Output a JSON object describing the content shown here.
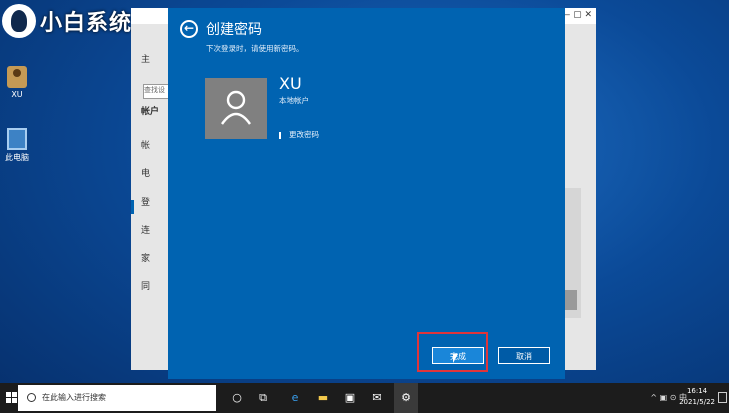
{
  "watermark": {
    "text": "小白系统"
  },
  "desktop": {
    "icons": [
      {
        "label": "XU",
        "icon": "user-folder-icon"
      },
      {
        "label": "此电脑",
        "icon": "this-pc-icon"
      }
    ]
  },
  "settings_window": {
    "search_placeholder": "查找设",
    "nav": [
      "主",
      "帐户",
      "帐",
      "电",
      "登",
      "连",
      "家",
      "同"
    ],
    "controls": "—  ▢  ✕"
  },
  "dialog": {
    "title": "创建密码",
    "subtitle": "下次登录时，请使用新密码。",
    "username": "XU",
    "account_type": "本地帐户",
    "password_link": "更改密码",
    "done_label": "完成",
    "cancel_label": "取消",
    "highlight_color": "#e0353a",
    "background_color": "#0063b1"
  },
  "taskbar": {
    "search_placeholder": "在此输入进行搜索",
    "tray_text": "^ ▣ ⊙ 中",
    "time": "16:14",
    "date": "2021/5/22"
  }
}
